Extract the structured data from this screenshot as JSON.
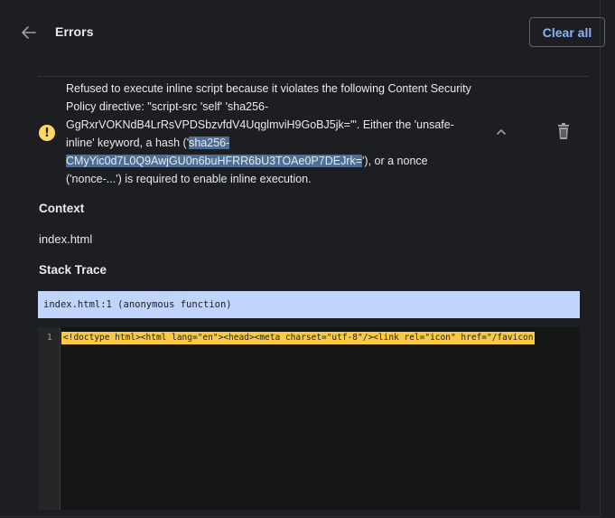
{
  "header": {
    "title": "Errors",
    "clear_all_label": "Clear all"
  },
  "error": {
    "message_part1": "Refused to execute inline script because it violates the following Content Security Policy directive: \"script-src 'self' 'sha256-GgRxrVOKNdB4LrRsVPDSbzvfdV4UqglmviH9GoBJ5jk='\". Either the 'unsafe-inline' keyword, a hash ('",
    "message_highlight": "sha256-CMyYic0d7L0Q9AwjGU0n6buHFRR6bU3TOAe0P7DEJrk=",
    "message_part2": "'), or a nonce ('nonce-...') is required to enable inline execution.",
    "severity_icon": "warning-icon"
  },
  "context": {
    "heading": "Context",
    "value": "index.html"
  },
  "stack_trace": {
    "heading": "Stack Trace",
    "entries": [
      "index.html:1 (anonymous function)"
    ]
  },
  "source": {
    "line_number": "1",
    "code": "<!doctype html><html lang=\"en\"><head><meta charset=\"utf-8\"/><link rel=\"icon\" href=\"/favicon"
  },
  "colors": {
    "background": "#1d1e21",
    "accent": "#8ab4f8",
    "warning": "#fdd663",
    "stack_highlight": "#c1d4fb",
    "code_highlight": "#f9c846"
  }
}
